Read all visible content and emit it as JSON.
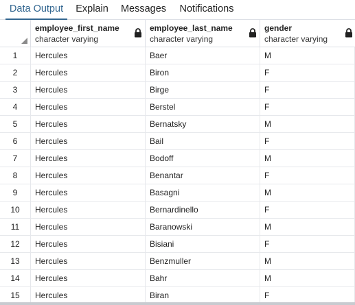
{
  "tabs": [
    {
      "label": "Data Output",
      "active": true
    },
    {
      "label": "Explain",
      "active": false
    },
    {
      "label": "Messages",
      "active": false
    },
    {
      "label": "Notifications",
      "active": false
    }
  ],
  "columns": [
    {
      "name": "employee_first_name",
      "type": "character varying",
      "icon": "lock-icon"
    },
    {
      "name": "employee_last_name",
      "type": "character varying",
      "icon": "lock-icon"
    },
    {
      "name": "gender",
      "type": "character varying",
      "icon": "lock-icon"
    }
  ],
  "rows": [
    {
      "num": "1",
      "first": "Hercules",
      "last": "Baer",
      "gender": "M"
    },
    {
      "num": "2",
      "first": "Hercules",
      "last": "Biron",
      "gender": "F"
    },
    {
      "num": "3",
      "first": "Hercules",
      "last": "Birge",
      "gender": "F"
    },
    {
      "num": "4",
      "first": "Hercules",
      "last": "Berstel",
      "gender": "F"
    },
    {
      "num": "5",
      "first": "Hercules",
      "last": "Bernatsky",
      "gender": "M"
    },
    {
      "num": "6",
      "first": "Hercules",
      "last": "Bail",
      "gender": "F"
    },
    {
      "num": "7",
      "first": "Hercules",
      "last": "Bodoff",
      "gender": "M"
    },
    {
      "num": "8",
      "first": "Hercules",
      "last": "Benantar",
      "gender": "F"
    },
    {
      "num": "9",
      "first": "Hercules",
      "last": "Basagni",
      "gender": "M"
    },
    {
      "num": "10",
      "first": "Hercules",
      "last": "Bernardinello",
      "gender": "F"
    },
    {
      "num": "11",
      "first": "Hercules",
      "last": "Baranowski",
      "gender": "M"
    },
    {
      "num": "12",
      "first": "Hercules",
      "last": "Bisiani",
      "gender": "F"
    },
    {
      "num": "13",
      "first": "Hercules",
      "last": "Benzmuller",
      "gender": "M"
    },
    {
      "num": "14",
      "first": "Hercules",
      "last": "Bahr",
      "gender": "M"
    },
    {
      "num": "15",
      "first": "Hercules",
      "last": "Biran",
      "gender": "F"
    }
  ],
  "colors": {
    "accent": "#326690",
    "grid_line": "#e6e8ec"
  }
}
